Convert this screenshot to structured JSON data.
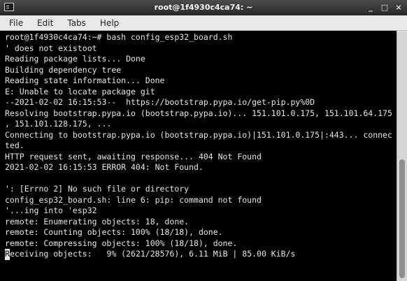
{
  "window": {
    "title": "root@1f4930c4ca74: ~",
    "controls": {
      "minimize": "_",
      "maximize": "□",
      "close": "×"
    }
  },
  "menu": {
    "items": [
      "File",
      "Edit",
      "Tabs",
      "Help"
    ]
  },
  "terminal": {
    "lines": [
      "root@1f4930c4ca74:~# bash config_esp32_board.sh",
      "' does not existoot",
      "Reading package lists... Done",
      "Building dependency tree",
      "Reading state information... Done",
      "E: Unable to locate package git",
      "--2021-02-02 16:15:53--  https://bootstrap.pypa.io/get-pip.py%0D",
      "Resolving bootstrap.pypa.io (bootstrap.pypa.io)... 151.101.0.175, 151.101.64.175",
      ", 151.101.128.175, ...",
      "Connecting to bootstrap.pypa.io (bootstrap.pypa.io)|151.101.0.175|:443... connec",
      "ted.",
      "HTTP request sent, awaiting response... 404 Not Found",
      "2021-02-02 16:15:53 ERROR 404: Not Found.",
      "",
      "': [Errno 2] No such file or directory",
      "config_esp32_board.sh: line 6: pip: command not found",
      "'...ing into 'esp32",
      "remote: Enumerating objects: 18, done.",
      "remote: Counting objects: 100% (18/18), done.",
      "remote: Compressing objects: 100% (18/18), done."
    ],
    "cursor_char": "R",
    "last_line_rest": "eceiving objects:   9% (2621/28576), 6.11 MiB | 85.00 KiB/s"
  },
  "colors": {
    "terminal_bg": "#000000",
    "terminal_fg": "#e5e5e5",
    "titlebar": "#2f2f2f",
    "menubar": "#e9e9e9"
  },
  "icons": {
    "app": "terminal-icon"
  }
}
